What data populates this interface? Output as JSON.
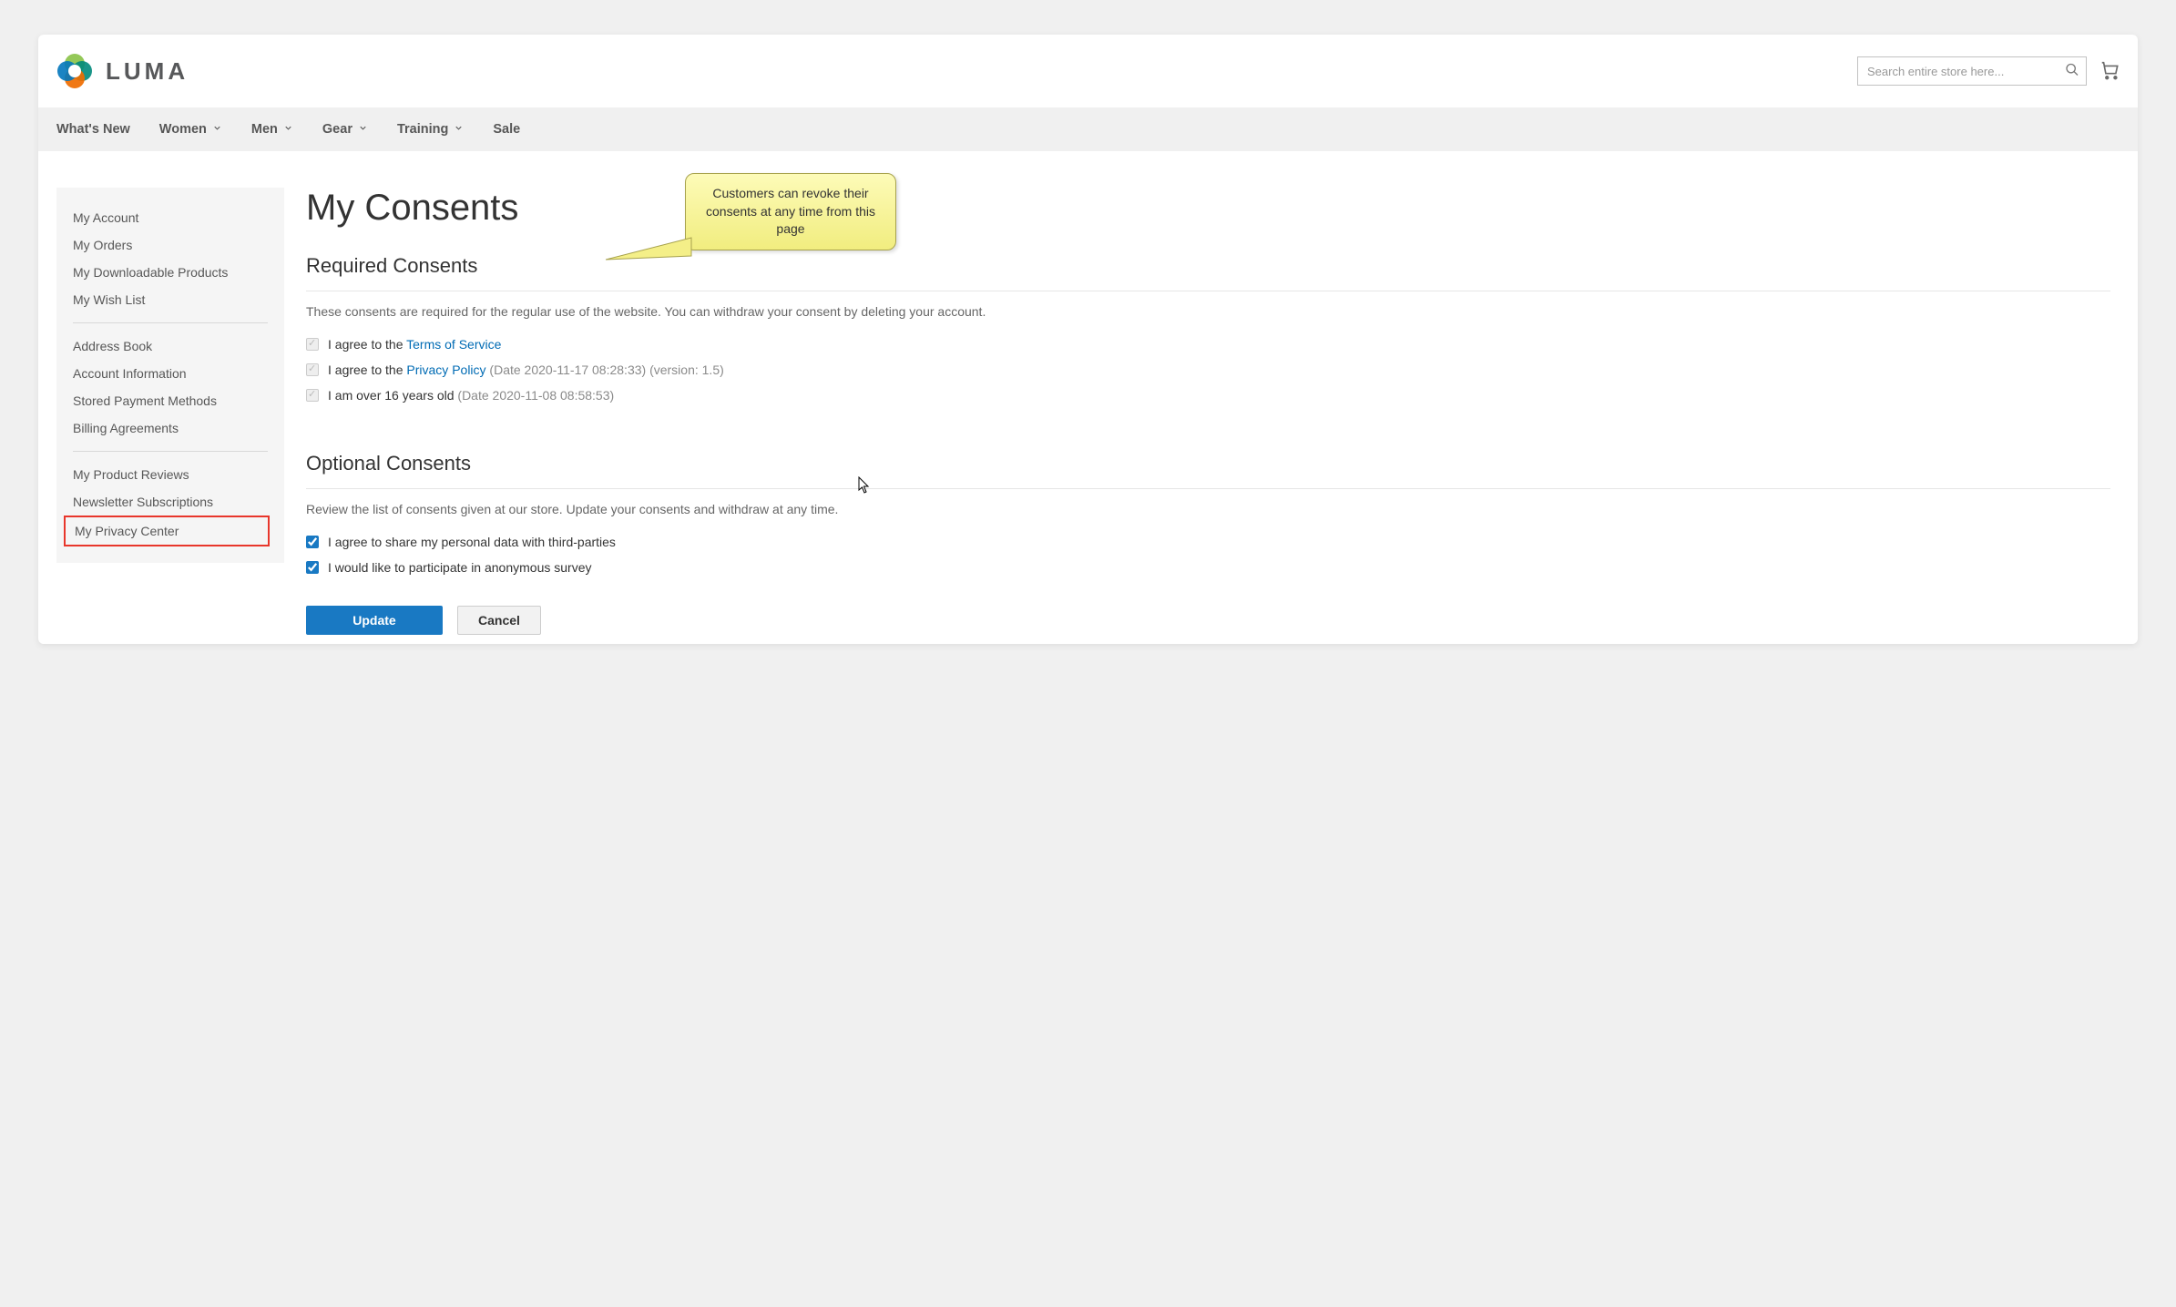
{
  "header": {
    "brand": "LUMA",
    "search_placeholder": "Search entire store here..."
  },
  "nav": {
    "items": [
      {
        "label": "What's New",
        "has_dropdown": false
      },
      {
        "label": "Women",
        "has_dropdown": true
      },
      {
        "label": "Men",
        "has_dropdown": true
      },
      {
        "label": "Gear",
        "has_dropdown": true
      },
      {
        "label": "Training",
        "has_dropdown": true
      },
      {
        "label": "Sale",
        "has_dropdown": false
      }
    ]
  },
  "sidebar": {
    "group1": [
      "My Account",
      "My Orders",
      "My Downloadable Products",
      "My Wish List"
    ],
    "group2": [
      "Address Book",
      "Account Information",
      "Stored Payment Methods",
      "Billing Agreements"
    ],
    "group3": [
      "My Product Reviews",
      "Newsletter Subscriptions",
      "My Privacy Center"
    ]
  },
  "main": {
    "title": "My Consents",
    "required": {
      "heading": "Required Consents",
      "desc": "These consents are required for the regular use of the website. You can withdraw your consent by deleting your account.",
      "items": [
        {
          "prefix": "I agree to the ",
          "link": "Terms of Service",
          "meta": ""
        },
        {
          "prefix": "I agree to the ",
          "link": "Privacy Policy",
          "meta": " (Date 2020-11-17 08:28:33) (version: 1.5)"
        },
        {
          "prefix": "I am over 16 years old",
          "link": "",
          "meta": " (Date 2020-11-08 08:58:53)"
        }
      ]
    },
    "optional": {
      "heading": "Optional Consents",
      "desc": "Review the list of consents given at our store. Update your consents and withdraw at any time.",
      "items": [
        {
          "label": "I agree to share my personal data with third-parties"
        },
        {
          "label": "I would like to participate in anonymous survey"
        }
      ]
    },
    "buttons": {
      "update": "Update",
      "cancel": "Cancel"
    }
  },
  "callout": {
    "text": "Customers can revoke their consents at any time from this page"
  }
}
